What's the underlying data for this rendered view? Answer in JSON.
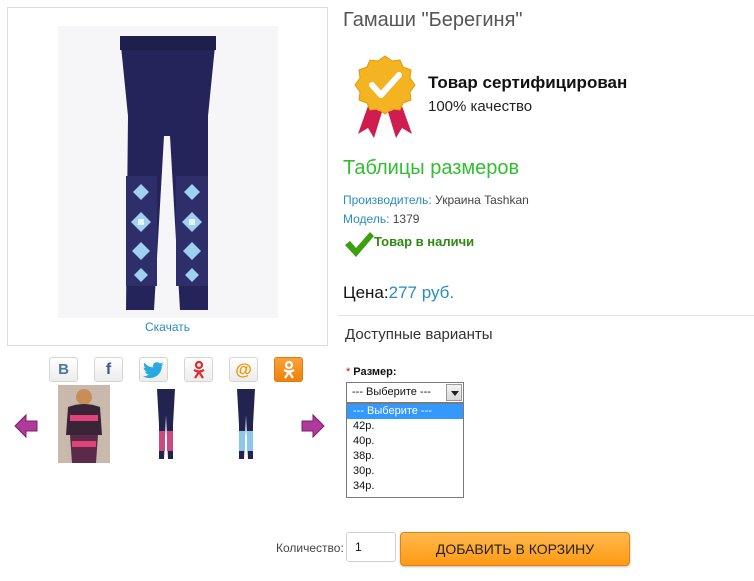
{
  "product": {
    "title": "Гамаши \"Берегиня\"",
    "download_label": "Скачать"
  },
  "share": {
    "icons": [
      "vk-icon",
      "facebook-icon",
      "twitter-icon",
      "odnoklassniki-icon",
      "mail-ru-icon",
      "ok-icon"
    ]
  },
  "certificate": {
    "title": "Товар сертифицирован",
    "subtitle": "100% качество"
  },
  "info": {
    "size_table_link": "Таблицы размеров",
    "manufacturer_label": "Производитель:",
    "manufacturer_value": "Украина Tashkan",
    "model_label": "Модель:",
    "model_value": "1379",
    "stock_status": "Товар в наличи"
  },
  "price": {
    "label": "Цена:",
    "value": "277 руб."
  },
  "variants": {
    "heading": "Доступные варианты",
    "required_mark": "*",
    "size_label": "Размер:",
    "selected": "--- Выберите ---",
    "options": [
      "--- Выберите ---",
      "42р.",
      "40р.",
      "38р.",
      "30р.",
      "34р."
    ]
  },
  "cart": {
    "quantity_label": "Количество:",
    "quantity_value": "1",
    "add_button": "ДОБАВИТЬ В КОРЗИНУ"
  },
  "colors": {
    "accent_blue": "#2a8bc1",
    "green_link": "#2fbf2f",
    "stock_green": "#2f8a12",
    "button_orange": "#ff9a14"
  }
}
